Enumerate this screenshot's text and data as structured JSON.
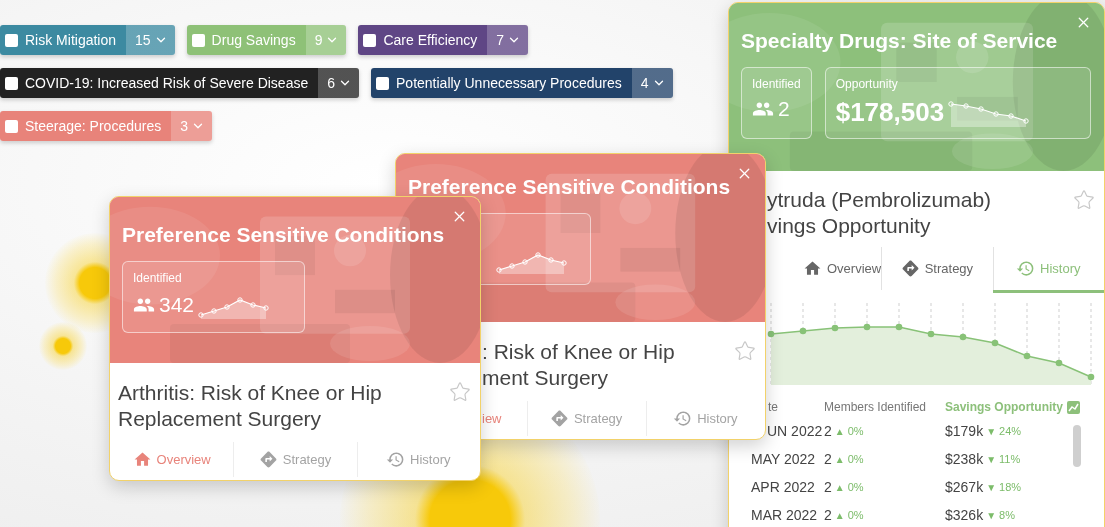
{
  "tag_rows": [
    [
      {
        "label": "Risk Mitigation",
        "count": "15",
        "checked": false,
        "color": "#3c8aa1"
      },
      {
        "label": "Drug Savings",
        "count": "9",
        "checked": false,
        "color": "#8ec177"
      },
      {
        "label": "Care Efficiency",
        "count": "7",
        "checked": false,
        "color": "#5f4685"
      }
    ],
    [
      {
        "label": "COVID-19: Increased Risk of Severe Disease",
        "count": "6",
        "checked": false,
        "color": "#222222"
      },
      {
        "label": "Potentially Unnecessary Procedures",
        "count": "4",
        "checked": false,
        "color": "#22436a"
      }
    ],
    [
      {
        "label": "Steerage: Procedures",
        "count": "3",
        "checked": false,
        "color": "#e8837a"
      }
    ]
  ],
  "cards": [
    {
      "color": "#8dc07b",
      "title": "Specialty Drugs: Site of Service",
      "stats": [
        {
          "kind": "members",
          "label": "Identified",
          "value": "2"
        },
        {
          "kind": "money",
          "label": "Opportunity",
          "value": "$178,503",
          "sparkline": true
        }
      ],
      "title_lines": [
        "ytruda (Pembrolizumab)",
        "vings Opportunity"
      ],
      "starred": false,
      "tabs": [
        {
          "kind": "overview",
          "label": "Overview",
          "selected": false,
          "disabled": false
        },
        {
          "kind": "strategy",
          "label": "Strategy",
          "selected": false,
          "disabled": false
        },
        {
          "kind": "history",
          "label": "History",
          "selected": true,
          "disabled": false
        }
      ],
      "history": {
        "columns": [
          {
            "label": "te",
            "sorted": false
          },
          {
            "label": "Members Identified",
            "sorted": false
          },
          {
            "label": "Savings Opportunity",
            "sorted": true
          }
        ],
        "rows": [
          {
            "date": "UN 2022",
            "members": "2",
            "members_trend": "▲",
            "members_change": "0%",
            "savings": "$179k",
            "savings_trend": "▼",
            "savings_change": "24%"
          },
          {
            "date": "MAY 2022",
            "members": "2",
            "members_trend": "▲",
            "members_change": "0%",
            "savings": "$238k",
            "savings_trend": "▼",
            "savings_change": "11%"
          },
          {
            "date": "APR 2022",
            "members": "2",
            "members_trend": "▲",
            "members_change": "0%",
            "savings": "$267k",
            "savings_trend": "▼",
            "savings_change": "18%"
          },
          {
            "date": "MAR 2022",
            "members": "2",
            "members_trend": "▲",
            "members_change": "0%",
            "savings": "$326k",
            "savings_trend": "▼",
            "savings_change": "8%"
          }
        ]
      }
    },
    {
      "color": "#e8847b",
      "title": "Preference Sensitive Conditions",
      "stats": [
        {
          "kind": "members",
          "sparkline": true
        }
      ],
      "title_lines": [
        ": Risk of Knee or Hip",
        "ment Surgery"
      ],
      "starred": false,
      "tabs": [
        {
          "kind": "overview",
          "label": "iew",
          "selected": true,
          "disabled": false
        },
        {
          "kind": "strategy",
          "label": "Strategy",
          "selected": false,
          "disabled": true
        },
        {
          "kind": "history",
          "label": "History",
          "selected": false,
          "disabled": true
        }
      ]
    },
    {
      "color": "#e8847b",
      "title": "Preference Sensitive Conditions",
      "stats": [
        {
          "kind": "members",
          "label": "Identified",
          "value": "342",
          "sparkline": true
        }
      ],
      "title_lines": [
        "Arthritis: Risk of Knee or Hip",
        "Replacement Surgery"
      ],
      "starred": false,
      "tabs": [
        {
          "kind": "overview",
          "label": "Overview",
          "selected": true,
          "disabled": false
        },
        {
          "kind": "strategy",
          "label": "Strategy",
          "selected": false,
          "disabled": true
        },
        {
          "kind": "history",
          "label": "History",
          "selected": false,
          "disabled": true
        }
      ]
    }
  ]
}
